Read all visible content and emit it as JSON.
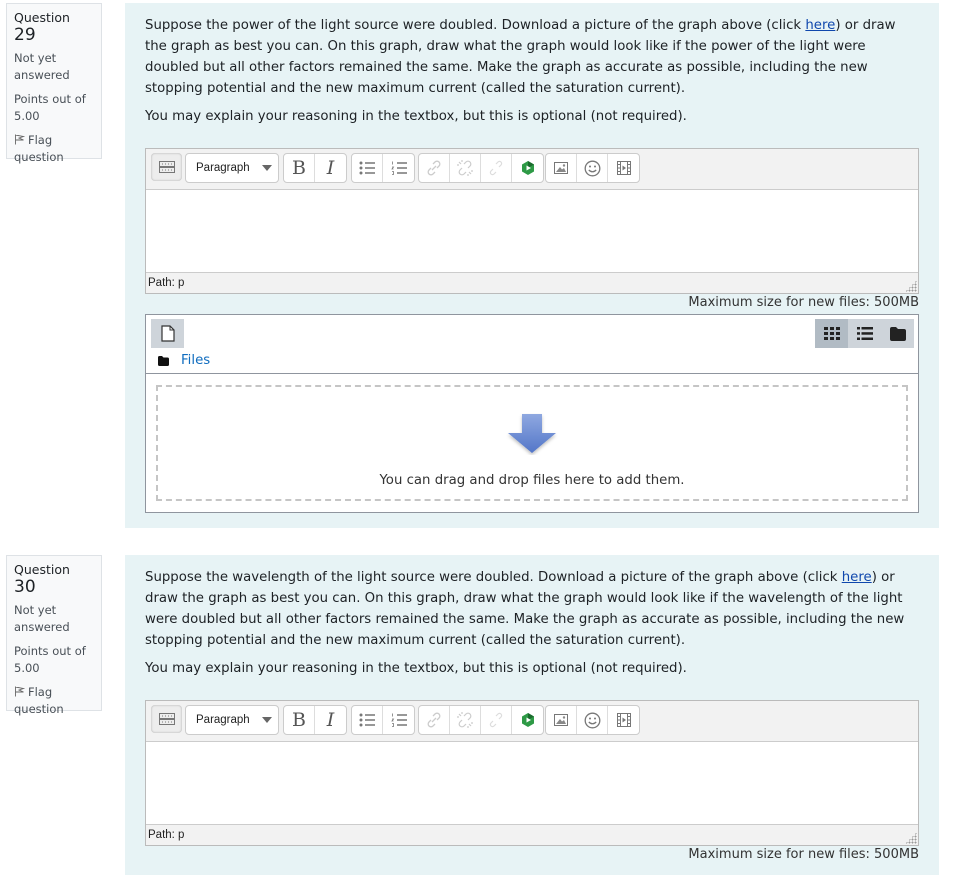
{
  "questions": [
    {
      "label": "Question",
      "number": "29",
      "state": "Not yet answered",
      "grade": "Points out of 5.00",
      "flag_label": "Flag question",
      "text_before_link": "Suppose the power of the light source were doubled. Download a picture of the graph above (click ",
      "link_text": "here",
      "text_after_link": ") or draw the graph as best you can. On this graph, draw what the graph would look like if the power of the light were doubled but all other factors remained the same. Make the graph as accurate as possible, including the new stopping potential and the new maximum current (called the saturation current).",
      "optional_note": "You may explain your reasoning in the textbox, but this is optional (not required).",
      "editor": {
        "format_select": "Paragraph",
        "bold": "B",
        "italic": "I",
        "path": "Path: p",
        "content": ""
      },
      "filemanager": {
        "max_size": "Maximum size for new files: 500MB",
        "path_label": "Files",
        "drop_text": "You can drag and drop files here to add them."
      }
    },
    {
      "label": "Question",
      "number": "30",
      "state": "Not yet answered",
      "grade": "Points out of 5.00",
      "flag_label": "Flag question",
      "text_before_link": "Suppose the wavelength of the light source were doubled. Download a picture of the graph above (click ",
      "link_text": "here",
      "text_after_link": ") or draw the graph as best you can. On this graph, draw what the graph would look like if the wavelength of the light were doubled but all other factors remained the same. Make the graph as accurate as possible, including the new stopping potential and the new maximum current (called the saturation current).",
      "optional_note": "You may explain your reasoning in the textbox, but this is optional (not required).",
      "editor": {
        "format_select": "Paragraph",
        "bold": "B",
        "italic": "I",
        "path": "Path: p",
        "content": ""
      },
      "filemanager": {
        "max_size": "Maximum size for new files: 500MB"
      }
    }
  ],
  "colors": {
    "content_bg": "#e7f3f5",
    "link": "#0f47ad",
    "files_link": "#0f6cbf",
    "drop_arrow": "#5b7fcf"
  }
}
